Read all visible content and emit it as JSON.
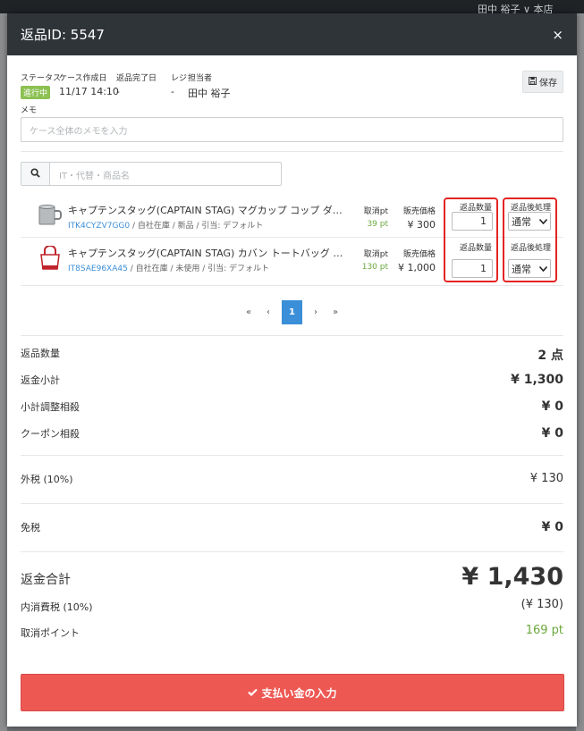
{
  "background": {
    "user_text": "田中 裕子 ∨    本店"
  },
  "modal": {
    "title": "返品ID: 5547",
    "close_label": "×"
  },
  "meta": {
    "status_label": "ステータス",
    "status_value": "進行中",
    "created_label": "ケース作成日",
    "created_value": "11/17 14:10",
    "completed_label": "返品完了日",
    "completed_value": "-",
    "register_label": "レジ",
    "register_value": "-",
    "staff_label": "担当者",
    "staff_value": "田中 裕子",
    "save_label": "保存"
  },
  "memo": {
    "label": "メモ",
    "placeholder": "ケース全体のメモを入力"
  },
  "search": {
    "placeholder": "IT・代替・商品名"
  },
  "items": [
    {
      "name": "キャプテンスタッグ(CAPTAIN STAG) マグカップ コップ ダブルステンレス...",
      "code": "ITK4CYZV7GG0",
      "detail": " / 自社在庫 / 新品 / 引当: デフォルト",
      "pt_label": "取消pt",
      "pt_value": "39 pt",
      "price_label": "販売価格",
      "price_value": "¥ 300",
      "qty_label": "返品数量",
      "qty_value": "1",
      "proc_label": "返品後処理",
      "proc_value": "通常"
    },
    {
      "name": "キャプテンスタッグ(CAPTAIN STAG) カバン トートバッグ レッド M M-...",
      "code": "IT8SAE96XA45",
      "detail": " / 自社在庫 / 未使用 / 引当: デフォルト",
      "pt_label": "取消pt",
      "pt_value": "130 pt",
      "price_label": "販売価格",
      "price_value": "¥ 1,000",
      "qty_label": "返品数量",
      "qty_value": "1",
      "proc_label": "返品後処理",
      "proc_value": "通常"
    }
  ],
  "pager": {
    "first": "«",
    "prev": "‹",
    "current": "1",
    "next": "›",
    "last": "»"
  },
  "summary": {
    "qty_label": "返品数量",
    "qty_value": "2 点",
    "subtotal_label": "返金小計",
    "subtotal_value": "¥ 1,300",
    "adjust_label": "小計調整相殺",
    "adjust_value": "¥ 0",
    "coupon_label": "クーポン相殺",
    "coupon_value": "¥ 0",
    "ext_tax_label": "外税 (10%)",
    "ext_tax_value": "¥ 130",
    "tax_free_label": "免税",
    "tax_free_value": "¥ 0",
    "total_label": "返金合計",
    "total_value": "¥ 1,430",
    "inc_tax_label": "内消費税 (10%)",
    "inc_tax_value": "(¥ 130)",
    "points_label": "取消ポイント",
    "points_value": "169 pt"
  },
  "pay_button_label": "支払い金の入力",
  "colors": {
    "header_bg": "#2f3439",
    "status_green": "#8cc152",
    "link_blue": "#3b8fd8",
    "highlight_red": "#e32423",
    "pay_red": "#ee5853",
    "point_green": "#6ba83d"
  }
}
